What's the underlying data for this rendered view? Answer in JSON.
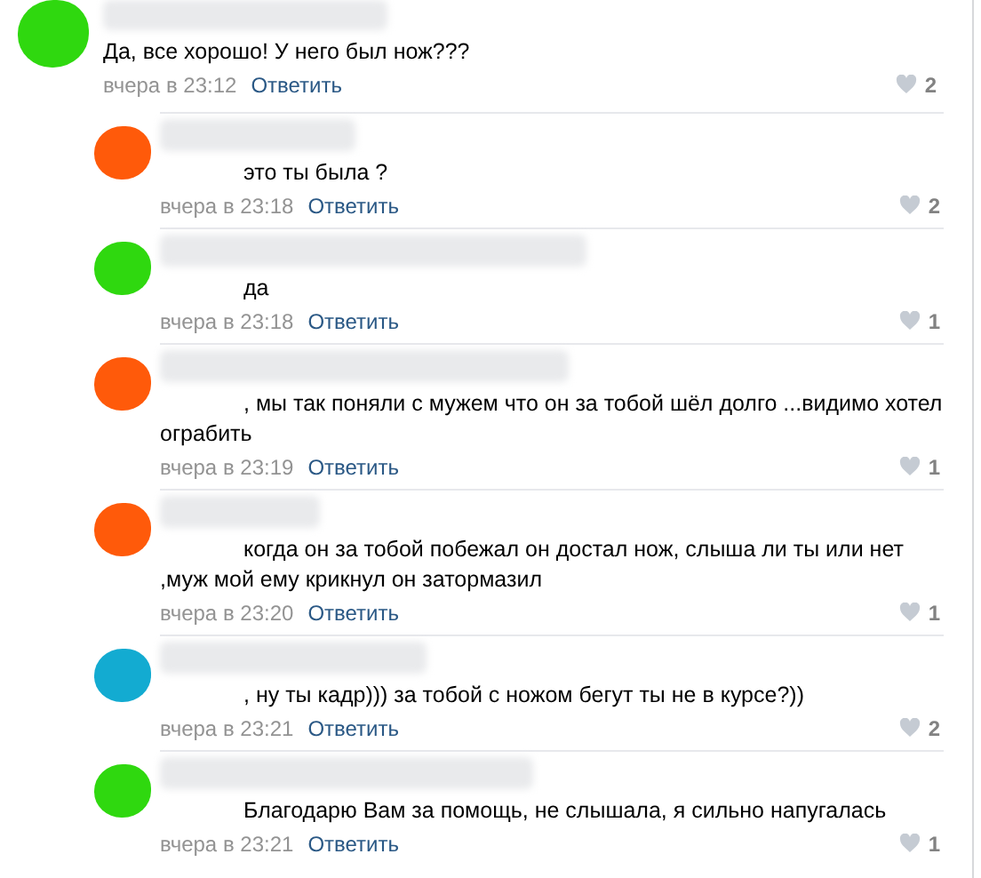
{
  "comments": [
    {
      "color": "#2fd80f",
      "text": "Да, все хорошо! У него был нож???",
      "time": "вчера в 23:12",
      "reply_label": "Ответить",
      "likes": "2",
      "children": [
        {
          "color": "#ff5a0a",
          "text": "это ты была ?",
          "time": "вчера в 23:18",
          "reply_label": "Ответить",
          "likes": "2"
        },
        {
          "color": "#2fd80f",
          "text": "да",
          "time": "вчера в 23:18",
          "reply_label": "Ответить",
          "likes": "1"
        },
        {
          "color": "#ff5a0a",
          "text": ", мы так поняли с мужем что он за тобой шёл долго ...видимо хотел ограбить",
          "time": "вчера в 23:19",
          "reply_label": "Ответить",
          "likes": "1"
        },
        {
          "color": "#ff5a0a",
          "text": "когда он за тобой побежал он достал нож, слыша ли ты или нет ,муж мой ему крикнул он затормазил",
          "time": "вчера в 23:20",
          "reply_label": "Ответить",
          "likes": "1"
        },
        {
          "color": "#13abd1",
          "text": ", ну ты кадр))) за тобой с ножом бегут ты не в курсе?))",
          "time": "вчера в 23:21",
          "reply_label": "Ответить",
          "likes": "2"
        },
        {
          "color": "#2fd80f",
          "text": "Благодарю Вам за помощь, не слышала, я сильно напугалась",
          "time": "вчера в 23:21",
          "reply_label": "Ответить",
          "likes": "1"
        }
      ]
    }
  ]
}
